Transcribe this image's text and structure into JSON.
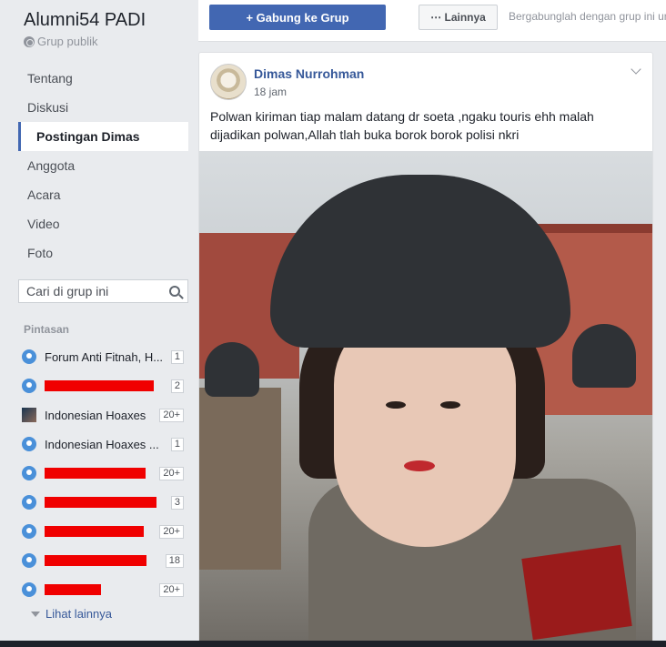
{
  "group": {
    "name": "Alumni54 PADI",
    "type": "Grup publik"
  },
  "nav": {
    "items": [
      {
        "label": "Tentang"
      },
      {
        "label": "Diskusi"
      },
      {
        "label": "Postingan Dimas"
      },
      {
        "label": "Anggota"
      },
      {
        "label": "Acara"
      },
      {
        "label": "Video"
      },
      {
        "label": "Foto"
      }
    ],
    "active": "Postingan Dimas"
  },
  "search": {
    "placeholder": "Cari di grup ini"
  },
  "shortcuts": {
    "title": "Pintasan",
    "items": [
      {
        "label": "Forum Anti Fitnah, H...",
        "badge": "1"
      },
      {
        "label": "",
        "badge": "2"
      },
      {
        "label": "Indonesian Hoaxes",
        "badge": "20+"
      },
      {
        "label": "Indonesian Hoaxes ...",
        "badge": "1"
      },
      {
        "label": "",
        "badge": "20+"
      },
      {
        "label": "",
        "badge": "3"
      },
      {
        "label": "",
        "badge": "20+"
      },
      {
        "label": "",
        "badge": "18"
      },
      {
        "label": "",
        "badge": "20+"
      }
    ],
    "more": "Lihat lainnya"
  },
  "topbar": {
    "join_label": "+ Gabung ke Grup",
    "more_label": "⋯ Lainnya",
    "join_text": "Bergabunglah dengan grup ini un"
  },
  "post": {
    "author": "Dimas Nurrohman",
    "time": "18 jam",
    "text": "Polwan kiriman tiap malam datang dr soeta ,ngaku touris ehh malah dijadikan polwan,Allah tlah buka borok borok polisi nkri"
  },
  "colors": {
    "brand": "#4267b2",
    "link": "#365899",
    "redaction": "#f00000"
  }
}
